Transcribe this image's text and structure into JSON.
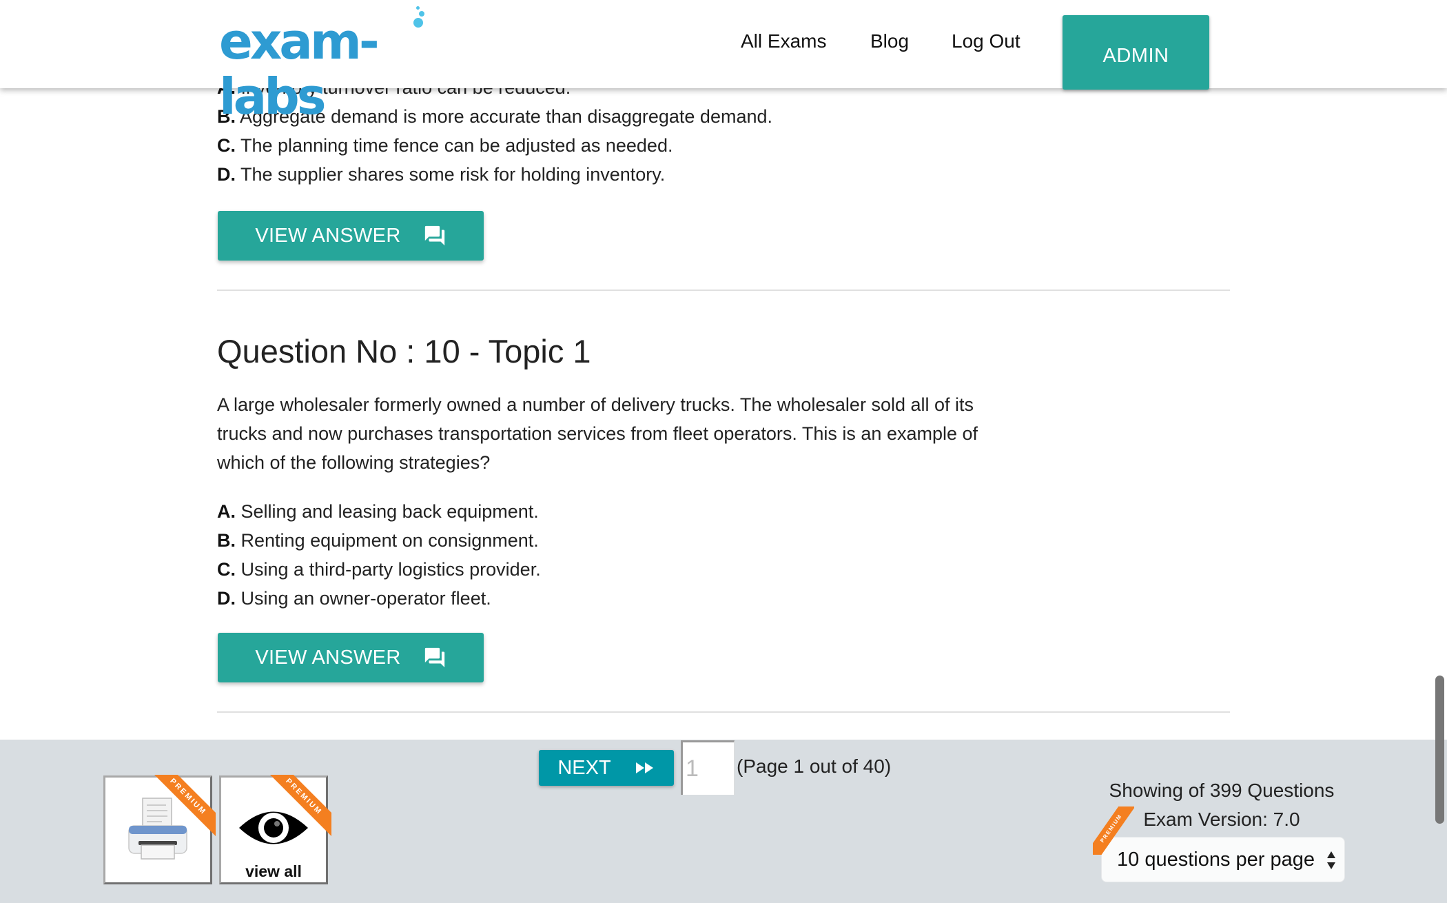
{
  "header": {
    "logo_text": "exam-labs",
    "nav": [
      {
        "label": "All Exams"
      },
      {
        "label": "Blog"
      },
      {
        "label": "Log Out"
      }
    ],
    "admin_label": "ADMIN"
  },
  "previous_question": {
    "options": [
      {
        "letter": "A.",
        "text": "Inventory turnover ratio can be reduced."
      },
      {
        "letter": "B.",
        "text": "Aggregate demand is more accurate than disaggregate demand."
      },
      {
        "letter": "C.",
        "text": "The planning time fence can be adjusted as needed."
      },
      {
        "letter": "D.",
        "text": "The supplier shares some risk for holding inventory."
      }
    ],
    "view_answer_label": "VIEW ANSWER"
  },
  "question": {
    "title": "Question No : 10 - Topic 1",
    "text": "A large wholesaler formerly owned a number of delivery trucks. The wholesaler sold all of its trucks and now purchases transportation services from fleet operators. This is an example of which of the following strategies?",
    "options": [
      {
        "letter": "A.",
        "text": "Selling and leasing back equipment."
      },
      {
        "letter": "B.",
        "text": "Renting equipment on consignment."
      },
      {
        "letter": "C.",
        "text": "Using a third-party logistics provider."
      },
      {
        "letter": "D.",
        "text": "Using an owner-operator fleet."
      }
    ],
    "view_answer_label": "VIEW ANSWER"
  },
  "footer": {
    "print_ribbon": "PREMIUM",
    "view_all_ribbon": "PREMIUM",
    "view_all_label": "view all",
    "next_label": "NEXT",
    "page_input_value": "1",
    "page_info": "(Page 1 out of 40)",
    "showing_text": "Showing of 399 Questions",
    "exam_version": "Exam Version: 7.0",
    "per_page_selected": "10 questions per page",
    "per_page_ribbon": "PREMIUM"
  },
  "colors": {
    "accent_teal": "#26a69a",
    "next_button": "#0097a7",
    "premium_orange": "#f47f20",
    "logo_blue": "#2e9bd2",
    "footer_bg": "#d8dde1"
  }
}
